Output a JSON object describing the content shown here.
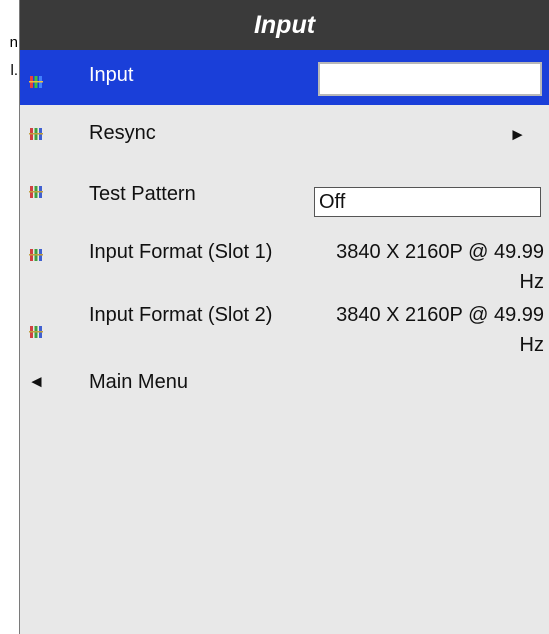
{
  "background_text": [
    "n",
    "l."
  ],
  "menu": {
    "title": "Input",
    "items": [
      {
        "label": "Input",
        "selected": true,
        "icon": "rgb-connector-icon",
        "value": ""
      },
      {
        "label": "Resync",
        "icon": "rgb-connector-icon",
        "arrow": "►"
      },
      {
        "label": "Test Pattern",
        "icon": "rgb-connector-icon",
        "value": "Off"
      },
      {
        "label": "Input Format (Slot 1)",
        "icon": "rgb-connector-icon",
        "value": "3840 X 2160P @ 49.99 Hz"
      },
      {
        "label": "Input Format (Slot 2)",
        "icon": "rgb-connector-icon",
        "value": "3840 X 2160P @ 49.99 Hz"
      }
    ],
    "back": {
      "arrow": "◄",
      "label": "Main Menu"
    }
  },
  "colors": {
    "title_bar": "#3a3a3a",
    "panel": "#e8e8e8",
    "selected_row": "#1a3fd9"
  }
}
